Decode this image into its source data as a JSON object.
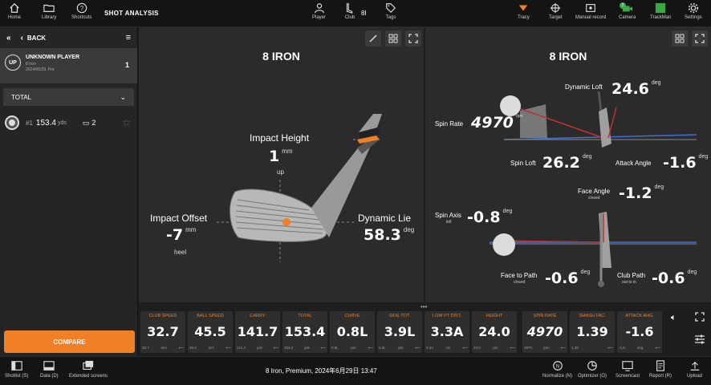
{
  "topbar": {
    "home": "Home",
    "library": "Library",
    "shortcuts": "Shortcuts",
    "title": "SHOT ANALYSIS",
    "player": "Player",
    "club": "Club",
    "club_value": "8I",
    "tags": "Tags",
    "tracy": "Tracy",
    "target": "Target",
    "manual_record": "Manual record",
    "camera": "Camera",
    "camera_badge": "2",
    "trackman": "TrackMan",
    "settings": "Settings"
  },
  "sidebar": {
    "back": "BACK",
    "player_initials": "UP",
    "player_name": "UNKNOWN PLAYER",
    "player_club": "8 Iron",
    "player_date": "2024/06/29, Pre",
    "player_count": "1",
    "total": "TOTAL",
    "shot_num": "#1",
    "shot_dist": "153.4",
    "shot_unit": "yds",
    "shot_video": "2",
    "compare": "COMPARE"
  },
  "left_panel": {
    "title": "8 IRON",
    "impact_height_label": "Impact Height",
    "impact_height_value": "1",
    "impact_height_unit": "mm",
    "impact_height_dir": "up",
    "impact_offset_label": "Impact Offset",
    "impact_offset_value": "-7",
    "impact_offset_unit": "mm",
    "impact_offset_dir": "heel",
    "dynamic_lie_label": "Dynamic Lie",
    "dynamic_lie_value": "58.3",
    "dynamic_lie_unit": "deg"
  },
  "right_panel": {
    "title": "8 IRON",
    "dynamic_loft_label": "Dynamic Loft",
    "dynamic_loft_value": "24.6",
    "spin_rate_label": "Spin Rate",
    "spin_rate_value": "4970",
    "spin_rate_unit": "rpm",
    "spin_loft_label": "Spin Loft",
    "spin_loft_value": "26.2",
    "attack_angle_label": "Attack Angle",
    "attack_angle_value": "-1.6",
    "face_angle_label": "Face Angle",
    "face_angle_value": "-1.2",
    "face_angle_dir": "closed",
    "spin_axis_label": "Spin Axis",
    "spin_axis_dir": "left",
    "spin_axis_value": "-0.8",
    "face_to_path_label": "Face to Path",
    "face_to_path_dir": "closed",
    "face_to_path_value": "-0.6",
    "club_path_label": "Club Path",
    "club_path_dir": "out to in",
    "club_path_value": "-0.6",
    "deg": "deg"
  },
  "metrics": [
    {
      "title": "CLUB SPEED",
      "value": "32.7",
      "small": "32.7",
      "unit": "m/s"
    },
    {
      "title": "BALL SPEED",
      "value": "45.5",
      "small": "45.5",
      "unit": "m/s"
    },
    {
      "title": "CARRY",
      "value": "141.7",
      "small": "141.7",
      "unit": "yds"
    },
    {
      "title": "TOTAL",
      "value": "153.4",
      "small": "153.4",
      "unit": "yds"
    },
    {
      "title": "CURVE",
      "value": "0.8L",
      "small": "0.8L",
      "unit": "yds"
    },
    {
      "title": "SIDE TOT.",
      "value": "3.9L",
      "small": "3.9L",
      "unit": "yds"
    },
    {
      "title": "LOW PT DIST.",
      "value": "3.3A",
      "small": "3.3A",
      "unit": "cm"
    },
    {
      "title": "HEIGHT",
      "value": "24.0",
      "small": "24.0",
      "unit": "yds"
    },
    {
      "title": "SPIN RATE",
      "value": "4970",
      "small": "4970",
      "unit": "rpm"
    },
    {
      "title": "SMASH FAC.",
      "value": "1.39",
      "small": "1.39",
      "unit": ""
    },
    {
      "title": "ATTACK ANG.",
      "value": "-1.6",
      "small": "-1.6",
      "unit": "deg"
    }
  ],
  "bottombar": {
    "shotlist": "Shotlist (S)",
    "data": "Data (D)",
    "extended": "Extended screens",
    "status": "8 Iron, Premium, 2024年6月29日 13:47",
    "normalize": "Normalize (N)",
    "optimizer": "Optimizer (O)",
    "screencast": "Screencast",
    "report": "Report (R)",
    "upload": "Upload"
  },
  "colors": {
    "accent": "#f07f26",
    "trackman_green": "#3aa845"
  }
}
